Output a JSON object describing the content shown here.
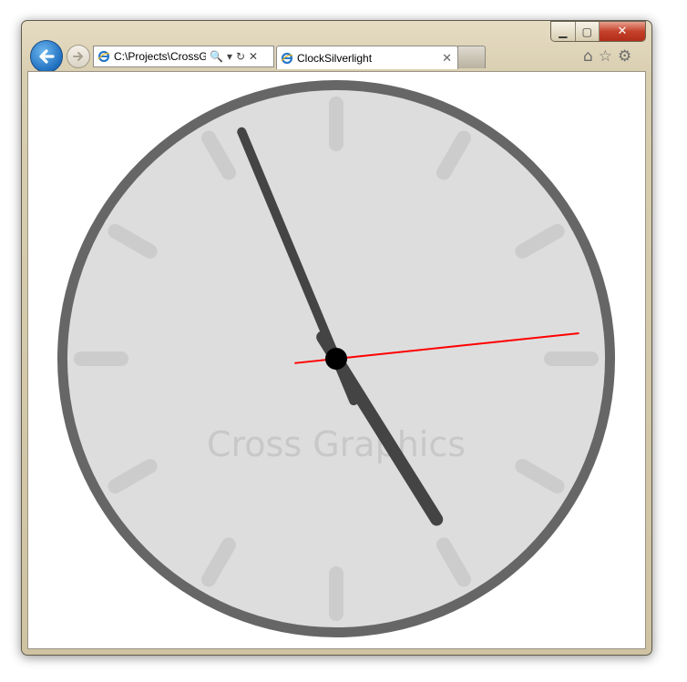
{
  "browser": {
    "address": "C:\\Projects\\CrossG",
    "tab_title": "ClockSilverlight",
    "tab_close": "✕",
    "caption": {
      "minimize": "▁",
      "maximize": "▢",
      "close": "✕"
    },
    "icons": {
      "back": "back-arrow-icon",
      "forward": "forward-arrow-icon",
      "search": "🔍",
      "dropdown": "▾",
      "refresh": "↻",
      "stop": "✕",
      "home": "⌂",
      "favorites": "☆",
      "tools": "⚙"
    }
  },
  "clock": {
    "watermark": "Cross Graphics",
    "colors": {
      "bezel": "#666666",
      "face": "#dddddd",
      "ticks": "#cccccc",
      "hands": "#444444",
      "second_hand": "#ff0000",
      "hub": "#000000",
      "watermark": "#c8c8c8"
    },
    "time": {
      "hour": 4,
      "minute": 56,
      "second": 14
    }
  }
}
